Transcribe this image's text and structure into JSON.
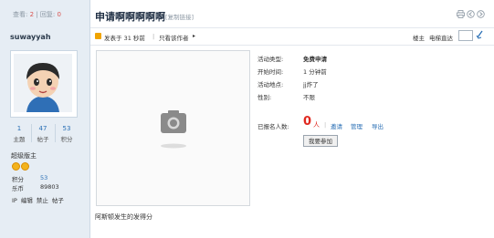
{
  "header": {
    "views_label": "查看:",
    "views_value": "2",
    "stat_sep": "|",
    "replies_label": "回复:",
    "replies_value": "0",
    "title": "申请啊啊啊啊啊",
    "copy_link": "[复制链接]",
    "icons": [
      "print-icon",
      "prev-thread-icon",
      "next-thread-icon"
    ]
  },
  "user": {
    "name": "suwayyah",
    "stats": [
      {
        "value": "1",
        "label": "主题"
      },
      {
        "value": "47",
        "label": "帖子"
      },
      {
        "value": "53",
        "label": "积分"
      }
    ],
    "title": "超级版主",
    "jifen_label": "积分",
    "jifen_value": "53",
    "lebi_label": "乐币",
    "lebi_value": "89803",
    "actions": [
      "IP",
      "编辑",
      "禁止",
      "帖子"
    ]
  },
  "meta": {
    "posted": "发表于 31 秒前",
    "sep": "|",
    "author_only": "只看该作者",
    "floor": "楼主",
    "jump": "电梯直达"
  },
  "activity": {
    "type_label": "活动类型:",
    "type_value": "免费申请",
    "start_label": "开始时间:",
    "start_value": "1 分钟前",
    "location_label": "活动地点:",
    "location_value": "jj炸了",
    "gender_label": "性别:",
    "gender_value": "不限",
    "signup_label": "已报名人数:",
    "signup_count": "0",
    "signup_unit": "人",
    "invite": "邀请",
    "manage": "管理",
    "export": "导出",
    "join_button": "我要参加"
  },
  "post": {
    "body": "阿斯顿发生的发得分"
  },
  "colors": {
    "sidebar_bg": "#e6edf4",
    "link": "#2a6fb5",
    "accent_red": "#e0281f",
    "title": "#1f2f44"
  }
}
